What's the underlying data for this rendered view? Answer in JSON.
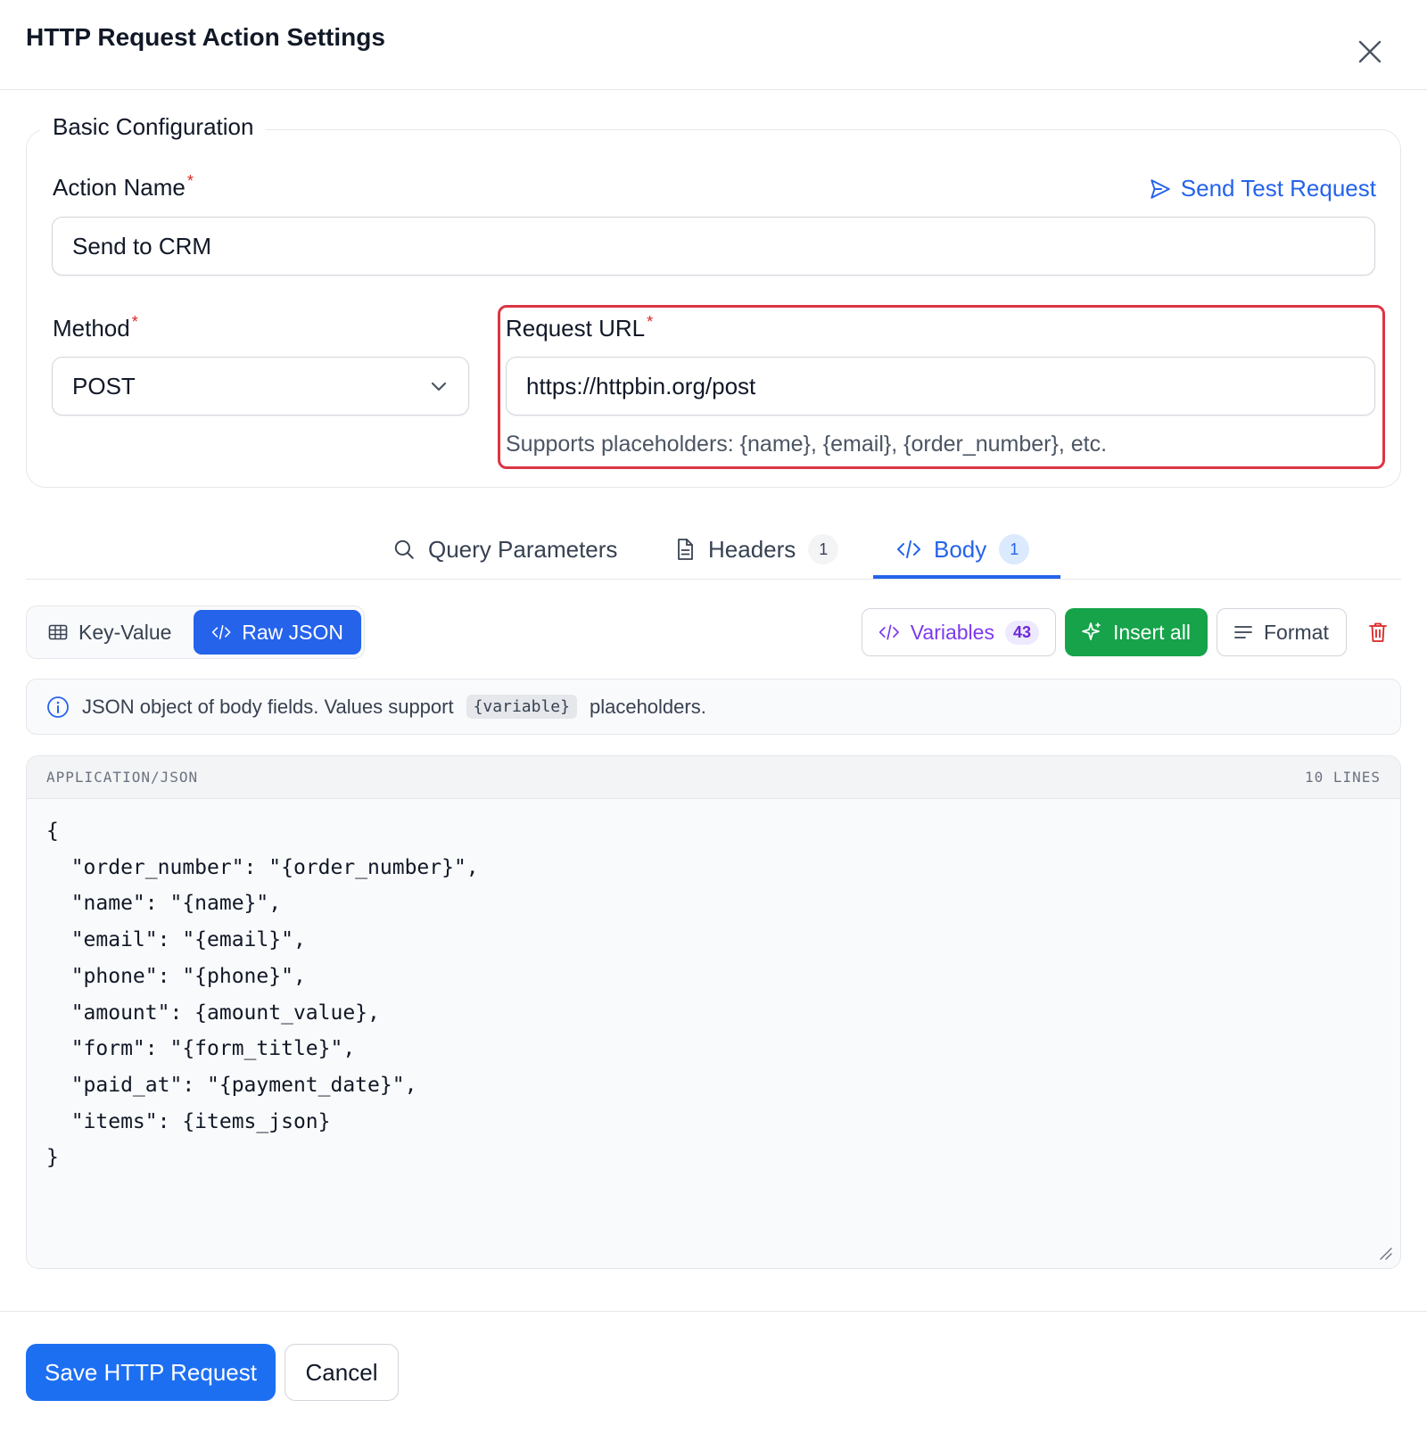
{
  "modal": {
    "title": "HTTP Request Action Settings"
  },
  "basic_config": {
    "legend": "Basic Configuration",
    "action_name_label": "Action Name",
    "action_name_value": "Send to CRM",
    "send_test_label": "Send Test Request",
    "method_label": "Method",
    "method_value": "POST",
    "url_label": "Request URL",
    "url_value": "https://httpbin.org/post",
    "url_hint": "Supports placeholders: {name}, {email}, {order_number}, etc.",
    "required_mark": "*"
  },
  "tabs": [
    {
      "label": "Query Parameters",
      "icon": "search-icon",
      "count": null,
      "active": false
    },
    {
      "label": "Headers",
      "icon": "document-icon",
      "count": "1",
      "active": false
    },
    {
      "label": "Body",
      "icon": "code-icon",
      "count": "1",
      "active": true
    }
  ],
  "body_toolbar": {
    "key_value_label": "Key-Value",
    "raw_json_label": "Raw JSON",
    "variables_label": "Variables",
    "variables_count": "43",
    "insert_all_label": "Insert all",
    "format_label": "Format"
  },
  "info": {
    "text_before": "JSON object of body fields. Values support",
    "code": "{variable}",
    "text_after": "placeholders."
  },
  "editor": {
    "language": "APPLICATION/JSON",
    "line_count": "10 LINES",
    "content": "{\n  \"order_number\": \"{order_number}\",\n  \"name\": \"{name}\",\n  \"email\": \"{email}\",\n  \"phone\": \"{phone}\",\n  \"amount\": {amount_value},\n  \"form\": \"{form_title}\",\n  \"paid_at\": \"{payment_date}\",\n  \"items\": {items_json}\n}"
  },
  "footer": {
    "save_label": "Save HTTP Request",
    "cancel_label": "Cancel"
  },
  "colors": {
    "primary": "#2563eb",
    "success": "#16a34a",
    "danger": "#dc2626",
    "highlight_border": "#dc3545",
    "variables_purple": "#7c3aed"
  }
}
